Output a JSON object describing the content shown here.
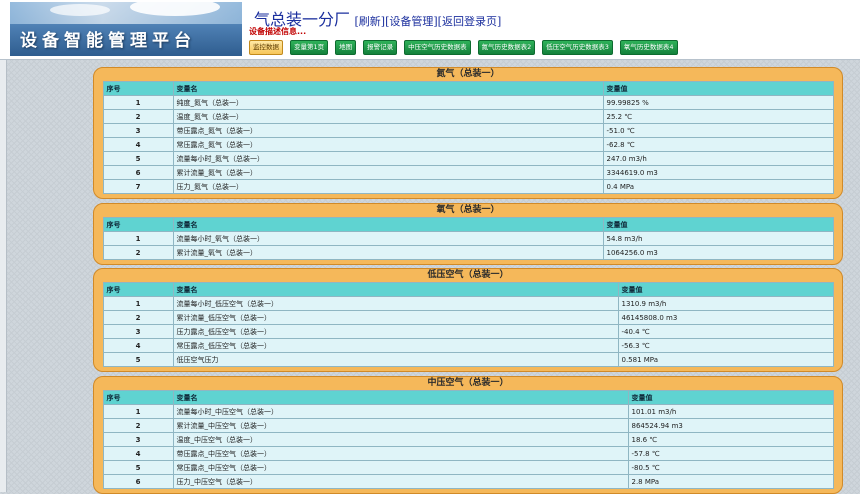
{
  "header": {
    "logo_text": "设备智能管理平台",
    "title_main": "气总装一分厂",
    "links": [
      "[刷新]",
      "[设备管理]",
      "[返回登录页]"
    ],
    "description": "设备描述信息..."
  },
  "tabs": [
    {
      "label": "监控数据",
      "active": true
    },
    {
      "label": "变量第1页",
      "active": false
    },
    {
      "label": "地图",
      "active": false
    },
    {
      "label": "报警记录",
      "active": false
    },
    {
      "label": "中压空气历史数据表",
      "active": false
    },
    {
      "label": "氮气历史数据表2",
      "active": false
    },
    {
      "label": "低压空气历史数据表3",
      "active": false
    },
    {
      "label": "氧气历史数据表4",
      "active": false
    }
  ],
  "columns": {
    "idx": "序号",
    "name": "变量名",
    "value": "变量值"
  },
  "panels": [
    {
      "title": "氮气（总装一）",
      "rows": [
        {
          "idx": "1",
          "name": "纯度_氮气（总装一）",
          "value": "99.99825 %"
        },
        {
          "idx": "2",
          "name": "温度_氮气（总装一）",
          "value": "25.2 ℃"
        },
        {
          "idx": "3",
          "name": "带压露点_氮气（总装一）",
          "value": "-51.0 ℃"
        },
        {
          "idx": "4",
          "name": "常压露点_氮气（总装一）",
          "value": "-62.8 ℃"
        },
        {
          "idx": "5",
          "name": "流量每小时_氮气（总装一）",
          "value": "247.0 m3/h"
        },
        {
          "idx": "6",
          "name": "累计流量_氮气（总装一）",
          "value": "3344619.0 m3"
        },
        {
          "idx": "7",
          "name": "压力_氮气（总装一）",
          "value": "0.4 MPa"
        }
      ]
    },
    {
      "title": "氧气（总装一）",
      "rows": [
        {
          "idx": "1",
          "name": "流量每小时_氧气（总装一）",
          "value": "54.8 m3/h"
        },
        {
          "idx": "2",
          "name": "累计流量_氧气（总装一）",
          "value": "1064256.0 m3"
        }
      ]
    },
    {
      "title": "低压空气（总装一）",
      "rows": [
        {
          "idx": "1",
          "name": "流量每小时_低压空气（总装一）",
          "value": "1310.9 m3/h"
        },
        {
          "idx": "2",
          "name": "累计流量_低压空气（总装一）",
          "value": "46145808.0 m3"
        },
        {
          "idx": "3",
          "name": "压力露点_低压空气（总装一）",
          "value": "-40.4 ℃"
        },
        {
          "idx": "4",
          "name": "常压露点_低压空气（总装一）",
          "value": "-56.3 ℃"
        },
        {
          "idx": "5",
          "name": "低压空气压力",
          "value": "0.581 MPa"
        }
      ]
    },
    {
      "title": "中压空气（总装一）",
      "rows": [
        {
          "idx": "1",
          "name": "流量每小时_中压空气（总装一）",
          "value": "101.01 m3/h"
        },
        {
          "idx": "2",
          "name": "累计流量_中压空气（总装一）",
          "value": "864524.94 m3"
        },
        {
          "idx": "3",
          "name": "温度_中压空气（总装一）",
          "value": "18.6 ℃"
        },
        {
          "idx": "4",
          "name": "带压露点_中压空气（总装一）",
          "value": "-57.8 ℃"
        },
        {
          "idx": "5",
          "name": "常压露点_中压空气（总装一）",
          "value": "-80.5 ℃"
        },
        {
          "idx": "6",
          "name": "压力_中压空气（总装一）",
          "value": "2.8 MPa"
        }
      ]
    }
  ]
}
